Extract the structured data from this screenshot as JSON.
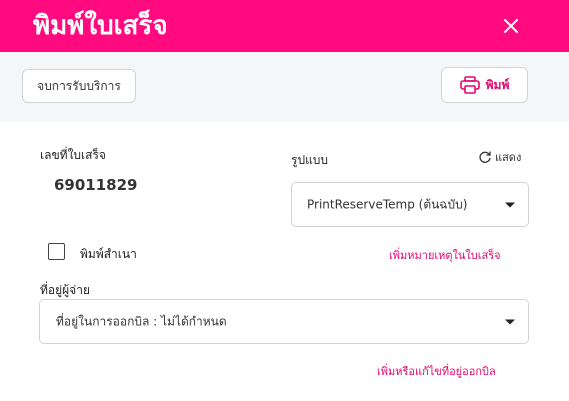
{
  "dialog": {
    "title": "พิมพ์ใบเสร็จ",
    "close_icon": "close-icon",
    "accent_color": "#ff0a7f"
  },
  "toolbar": {
    "end_service_label": "จบการรับบริการ",
    "print_label": "พิมพ์",
    "print_icon": "printer-icon"
  },
  "receipt": {
    "number_label": "เลขที่ใบเสร็จ",
    "number_value": "69011829"
  },
  "format": {
    "label": "รูปแบบ",
    "refresh_label": "แสดง",
    "refresh_icon": "refresh-icon",
    "selected": "PrintReserveTemp (ต้นฉบับ)"
  },
  "copy_option": {
    "label": "พิมพ์สำเนา",
    "checked": false
  },
  "links": {
    "add_note": "เพิ่มหมายเหตุในใบเสร็จ",
    "edit_address": "เพิ่มหรือแก้ไขที่อยู่ออกบิล"
  },
  "payer_address": {
    "label": "ที่อยู่ผู้จ่าย",
    "selected": "ที่อยู่ในการออกบิล : ไม่ได้กำหนด"
  }
}
